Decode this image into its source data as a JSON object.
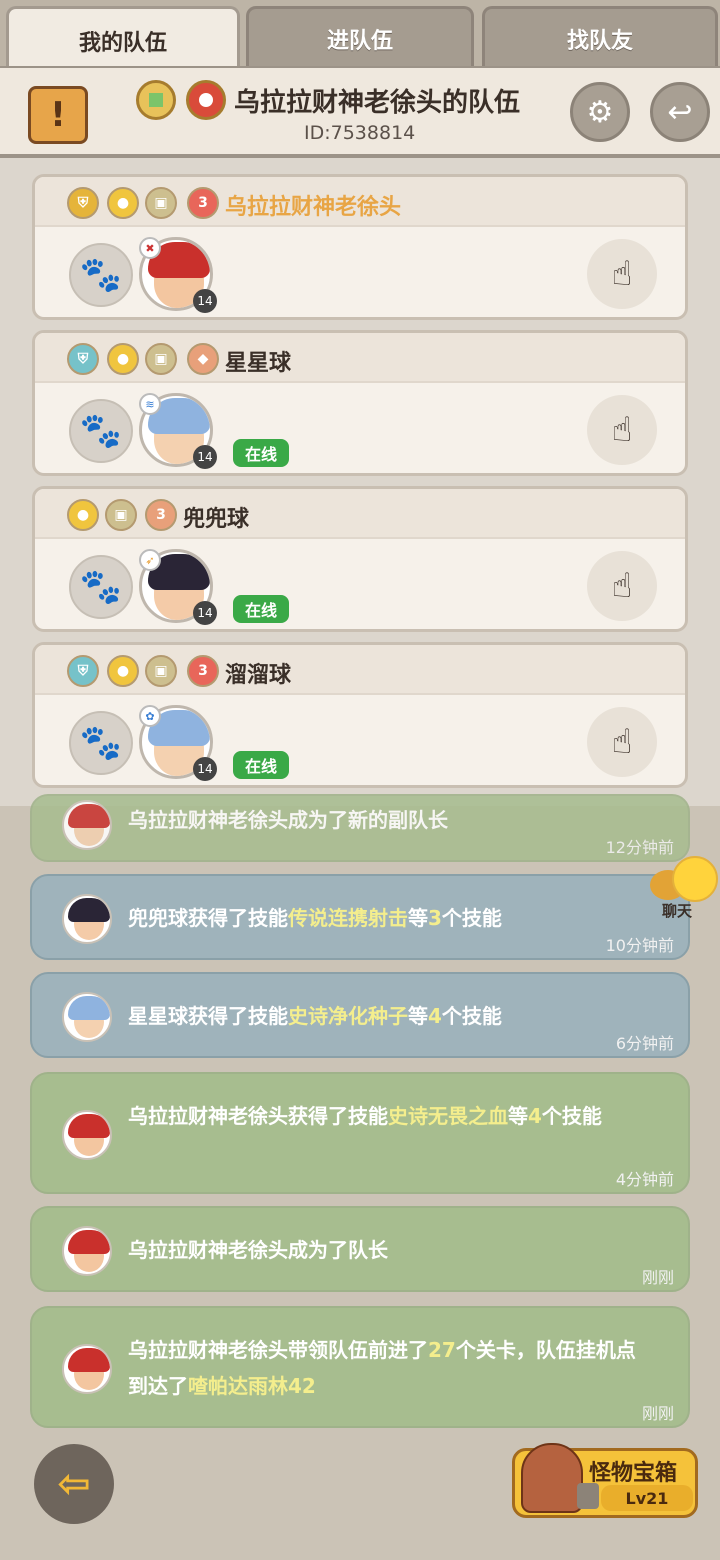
{
  "tabs": [
    {
      "label": "我的队伍"
    },
    {
      "label": "进队伍"
    },
    {
      "label": "找队友"
    }
  ],
  "header": {
    "title": "乌拉拉财神老徐头的队伍",
    "id_text": "ID:7538814"
  },
  "members": [
    {
      "name": "乌拉拉财神老徐头",
      "level": "14",
      "online": "",
      "hair": "#c9302c",
      "skin": "#f3c6a0"
    },
    {
      "name": "星星球",
      "level": "14",
      "online": "在线",
      "hair": "#8fb3df",
      "skin": "#f4d1b0"
    },
    {
      "name": "兜兜球",
      "level": "14",
      "online": "在线",
      "hair": "#2a2536",
      "skin": "#f4cba8"
    },
    {
      "name": "溜溜球",
      "level": "14",
      "online": "在线",
      "hair": "#8fb3df",
      "skin": "#f4d1b0"
    }
  ],
  "feed": [
    {
      "text": "乌拉拉财神老徐头成为了新的副队长",
      "time": "12分钟前"
    },
    {
      "pre": "兜兜球获得了技能",
      "skill": "传说连携射击",
      "post": "等",
      "count": "3",
      "end": "个技能",
      "time": "10分钟前"
    },
    {
      "pre": "星星球获得了技能",
      "skill": "史诗净化种子",
      "post": "等",
      "count": "4",
      "end": "个技能",
      "time": "6分钟前"
    },
    {
      "pre": "乌拉拉财神老徐头获得了技能",
      "skill": "史诗无畏之血",
      "post": "等",
      "count": "4",
      "end": "个技能",
      "time": "4分钟前"
    },
    {
      "text": "乌拉拉财神老徐头成为了队长",
      "time": "刚刚"
    },
    {
      "p1": "乌拉拉财神老徐头带领队伍前进了",
      "p2": "27",
      "p3": "个关卡，队伍挂机点到达了",
      "p4": "喳帕达雨林42",
      "time": "刚刚"
    }
  ],
  "chat": {
    "label": "聊天"
  },
  "chest": {
    "title": "怪物宝箱",
    "level": "Lv21"
  },
  "colors": {
    "online_green": "#3aa947",
    "leader_name": "#e8a545",
    "feed_green": "#a7bd8f",
    "feed_blue": "#9fb3bb"
  }
}
